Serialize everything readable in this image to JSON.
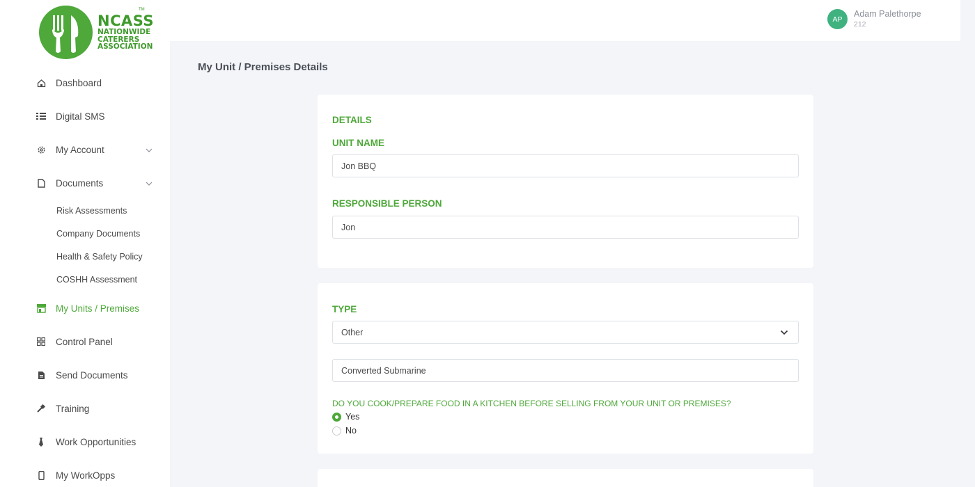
{
  "brand": {
    "name": "NCASS",
    "line1": "NATIONWIDE",
    "line2": "CATERERS",
    "line3": "ASSOCIATION",
    "tm": "TM",
    "color": "#4ea83a"
  },
  "user": {
    "initials": "AP",
    "name": "Adam Palethorpe",
    "id": "212"
  },
  "sidebar": {
    "items": [
      {
        "label": "Dashboard",
        "icon": "home-icon"
      },
      {
        "label": "Digital SMS",
        "icon": "list-icon"
      },
      {
        "label": "My Account",
        "icon": "gear-icon",
        "expandable": true
      },
      {
        "label": "Documents",
        "icon": "document-icon",
        "expandable": true
      },
      {
        "label": "My Units / Premises",
        "icon": "store-icon",
        "active": true
      },
      {
        "label": "Control Panel",
        "icon": "grid-icon"
      },
      {
        "label": "Send Documents",
        "icon": "file-icon"
      },
      {
        "label": "Training",
        "icon": "tools-icon"
      },
      {
        "label": "Work Opportunities",
        "icon": "tie-icon"
      },
      {
        "label": "My WorkOpps",
        "icon": "phone-icon"
      }
    ],
    "documents_sub": [
      "Risk Assessments",
      "Company Documents",
      "Health & Safety Policy",
      "COSHH Assessment"
    ]
  },
  "page": {
    "title": "My Unit / Premises Details"
  },
  "details_card": {
    "heading": "DETAILS",
    "unit_name_label": "UNIT NAME",
    "unit_name_value": "Jon BBQ",
    "responsible_label": "RESPONSIBLE PERSON",
    "responsible_value": "Jon"
  },
  "type_card": {
    "heading": "TYPE",
    "type_selected": "Other",
    "other_value": "Converted Submarine",
    "question": "DO YOU COOK/PREPARE FOOD IN A KITCHEN BEFORE SELLING FROM YOUR UNIT OR PREMISES?",
    "options": [
      "Yes",
      "No"
    ],
    "selected_option": "Yes"
  }
}
